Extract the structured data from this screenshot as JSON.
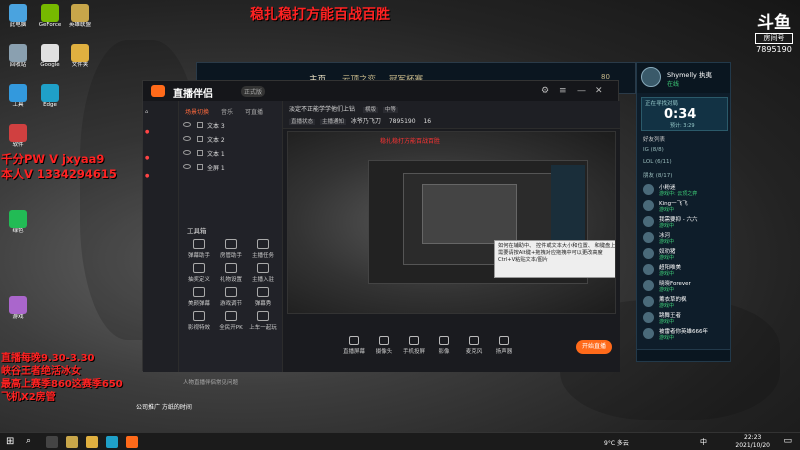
{
  "banner": "稳扎稳打方能百战百胜",
  "logo": {
    "line1": "斗鱼",
    "line2": "房间号",
    "room": "7895190"
  },
  "desktop_icons": [
    {
      "label": "此电脑",
      "color": "#4aa3df"
    },
    {
      "label": "GeForce",
      "color": "#76b900"
    },
    {
      "label": "英雄联盟",
      "color": "#c8a64a"
    },
    {
      "label": "回收站",
      "color": "#8aa0b0"
    },
    {
      "label": "Google",
      "color": "#e0e0e0"
    },
    {
      "label": "文件夹",
      "color": "#e0b040"
    },
    {
      "label": "工具",
      "color": "#3399dd"
    },
    {
      "label": "Edge",
      "color": "#1fa0c8"
    },
    {
      "label": "软件",
      "color": "#d04040"
    },
    {
      "label": "绿色",
      "color": "#22bb55"
    },
    {
      "label": "游戏",
      "color": "#aa66cc"
    }
  ],
  "overlay_left": [
    "千分PW V  jxyaa9",
    "本人V 1334294615"
  ],
  "overlay_bottom": [
    "直播每晚9.30-3.30",
    "峡谷王者绝活冰女",
    "最高上赛季860这赛季650",
    "飞机X2房管"
  ],
  "desktop_bottom_text": "公司推广  方纸的时间",
  "game_client": {
    "tabs": [
      "主页",
      "云顶之弈",
      "冠军杯赛"
    ],
    "level": "80"
  },
  "app": {
    "name": "直播伴侣",
    "badge": "正式版",
    "scene_tabs": [
      "场景切换",
      "音乐",
      "可直播"
    ],
    "sources": [
      "文本 3",
      "文本 2",
      "文本 1",
      "全屏 1"
    ],
    "tools_title": "工具箱",
    "tools": [
      "弹幕助手",
      "房管助手",
      "主播任务",
      "抽奖定义",
      "礼物设置",
      "主播入驻",
      "美颜弹幕",
      "游戏调节",
      "弹幕秀",
      "影视特效",
      "全民开PK",
      "上车一起玩"
    ],
    "tip": "人物直播伴侣常见问题",
    "title_line": "淡定不正能学学他们上钻",
    "mode_label": "横版",
    "quality_label": "中等",
    "status_chips": [
      "直播状态",
      "主播通知"
    ],
    "room_label": "冰爷乃飞刀",
    "room_id": "7895190",
    "viewer_count": "16",
    "preview_title": "稳扎稳打方能百战百胜",
    "tooltip": "如何在辅助中、 控件或文本大小和位置、 和键盘上需要请按Alt键+拖拽对应拖拽中可以更改高度 Ctrl+V粘贴文本/图片",
    "bottom_buttons": [
      "直播屏幕",
      "摄像头",
      "手机投屏",
      "影像",
      "麦克风",
      "扬声器"
    ],
    "live_button": "开始直播"
  },
  "chat": {
    "username": "Shymelly",
    "title_tag": "执夷",
    "status": "在线",
    "queue_label": "正在寻找对局",
    "timer": "0:34",
    "queue_sub": "预计: 3:29",
    "group_label": "好友列表",
    "groups": [
      "IG (8/8)",
      "LOL (6/11)",
      "朋友 (8/17)"
    ],
    "friends": [
      {
        "name": "小粉迷",
        "status": "游戏中: 云顶之弈"
      },
      {
        "name": "King一飞飞",
        "status": "游戏中"
      },
      {
        "name": "我需要抑 - 六六",
        "status": "游戏中"
      },
      {
        "name": "冰河",
        "status": "游戏中"
      },
      {
        "name": "奴劝猪",
        "status": "游戏中"
      },
      {
        "name": "超阳唯美",
        "status": "游戏中"
      },
      {
        "name": "晓晓Forever",
        "status": "游戏中"
      },
      {
        "name": "薰衣草的枫",
        "status": "游戏中"
      },
      {
        "name": "跳舞王者",
        "status": "游戏中"
      },
      {
        "name": "被雷者你英雄666年",
        "status": "游戏中"
      }
    ]
  },
  "taskbar": {
    "weather": "9°C 多云",
    "time": "22:23",
    "date": "2021/10/20",
    "lang": "中"
  }
}
